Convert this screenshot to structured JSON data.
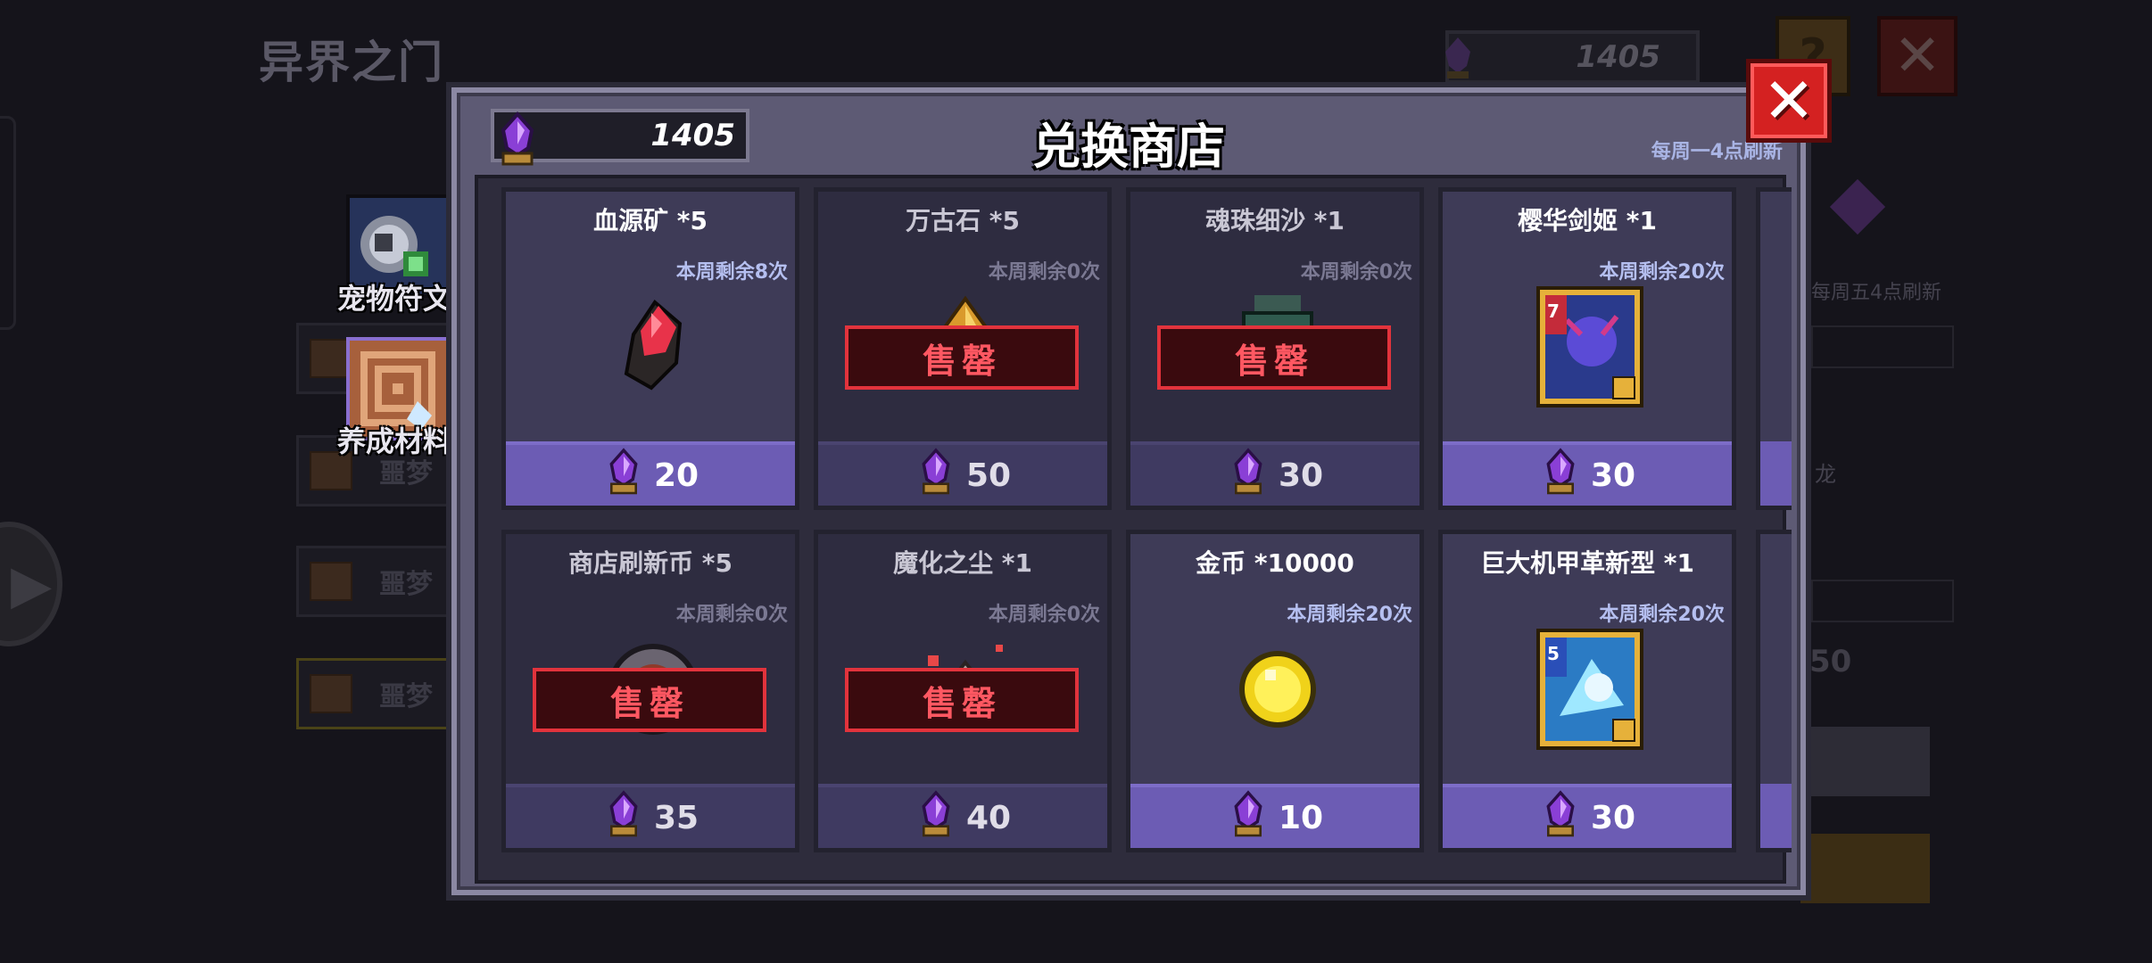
{
  "background": {
    "title": "异界之门",
    "currency_value": "1405",
    "help_glyph": "?",
    "close_glyph": "✕",
    "arrow_glyph": "▶",
    "list_row_label": "噩梦",
    "right_refresh_text": "每周五4点刷新",
    "right_dragon_text": "龙",
    "right_number_text": "50"
  },
  "categories": [
    {
      "label": "宠物符文",
      "icon": "pet-rune-icon"
    },
    {
      "label": "养成材料",
      "icon": "growth-material-icon"
    }
  ],
  "shop": {
    "title": "兑换商店",
    "currency_value": "1405",
    "refresh_note": "每周一4点刷新",
    "close_label": "✕",
    "sold_out_label": "售罄",
    "items": [
      {
        "name": "血源矿 *5",
        "stock": "本周剩余8次",
        "price": "20",
        "sold_out": false,
        "icon": "blood-ore-icon"
      },
      {
        "name": "万古石 *5",
        "stock": "本周剩余0次",
        "price": "50",
        "sold_out": true,
        "icon": "ancient-stone-icon"
      },
      {
        "name": "魂珠细沙 *1",
        "stock": "本周剩余0次",
        "price": "30",
        "sold_out": true,
        "icon": "soul-sand-jar-icon"
      },
      {
        "name": "樱华剑姬 *1",
        "stock": "本周剩余20次",
        "price": "30",
        "sold_out": false,
        "icon": "sakura-sword-card-icon",
        "badge": "7"
      },
      {
        "name": "商店刷新币 *5",
        "stock": "本周剩余0次",
        "price": "35",
        "sold_out": true,
        "icon": "refresh-coin-icon"
      },
      {
        "name": "魔化之尘 *1",
        "stock": "本周剩余0次",
        "price": "40",
        "sold_out": true,
        "icon": "demon-dust-icon"
      },
      {
        "name": "金币 *10000",
        "stock": "本周剩余20次",
        "price": "10",
        "sold_out": false,
        "icon": "gold-coin-icon"
      },
      {
        "name": "巨大机甲革新型 *1",
        "stock": "本周剩余20次",
        "price": "30",
        "sold_out": false,
        "icon": "mecha-card-icon",
        "badge": "5"
      }
    ]
  },
  "colors": {
    "gem_purple": "#8a3fd6",
    "price_bar": "#6c5cb4",
    "sold_out_red": "#e2333c",
    "close_red": "#d42121"
  }
}
